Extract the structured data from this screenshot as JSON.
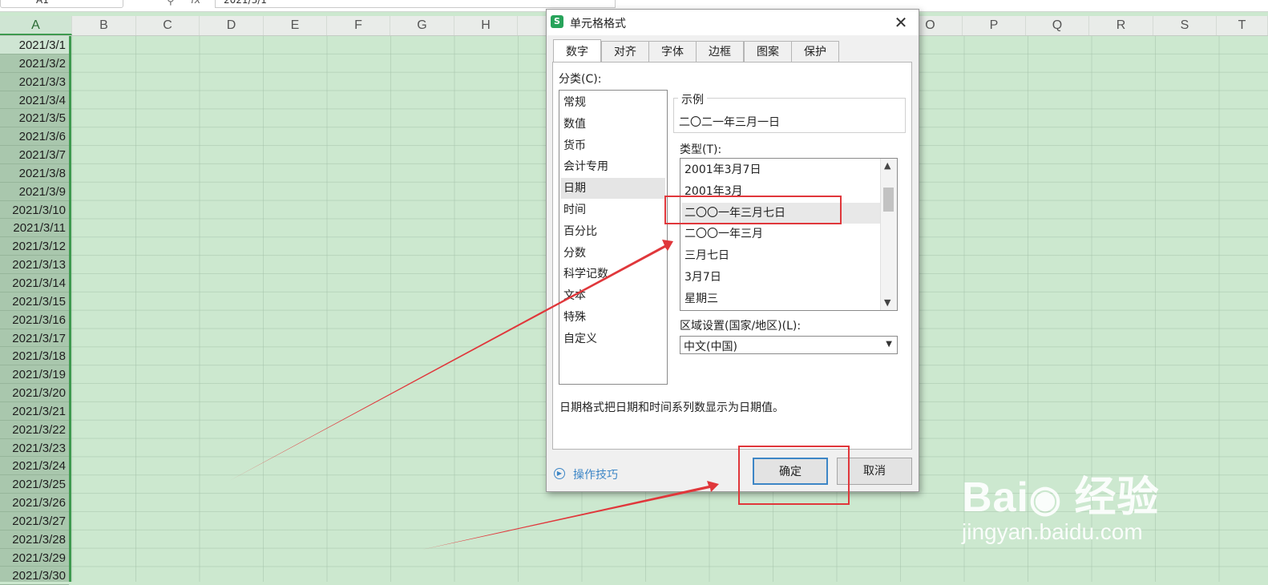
{
  "formula_bar": {
    "name_box": "A1",
    "fx_label": "fx",
    "formula_value": "2021/3/1"
  },
  "columns": [
    "A",
    "B",
    "C",
    "D",
    "E",
    "F",
    "G",
    "H",
    "",
    "",
    "",
    "",
    "",
    "",
    "O",
    "P",
    "Q",
    "R",
    "S",
    "T"
  ],
  "column_a_cells": [
    "2021/3/1",
    "2021/3/2",
    "2021/3/3",
    "2021/3/4",
    "2021/3/5",
    "2021/3/6",
    "2021/3/7",
    "2021/3/8",
    "2021/3/9",
    "2021/3/10",
    "2021/3/11",
    "2021/3/12",
    "2021/3/13",
    "2021/3/14",
    "2021/3/15",
    "2021/3/16",
    "2021/3/17",
    "2021/3/18",
    "2021/3/19",
    "2021/3/20",
    "2021/3/21",
    "2021/3/22",
    "2021/3/23",
    "2021/3/24",
    "2021/3/25",
    "2021/3/26",
    "2021/3/27",
    "2021/3/28",
    "2021/3/29",
    "2021/3/30"
  ],
  "dialog": {
    "app_icon": "S",
    "title": "单元格格式",
    "close_glyph": "✕",
    "tabs": [
      "数字",
      "对齐",
      "字体",
      "边框",
      "图案",
      "保护"
    ],
    "active_tab": "数字",
    "category_label": "分类(C):",
    "categories": [
      "常规",
      "数值",
      "货币",
      "会计专用",
      "日期",
      "时间",
      "百分比",
      "分数",
      "科学记数",
      "文本",
      "特殊",
      "自定义"
    ],
    "selected_category": "日期",
    "sample_label": "示例",
    "sample_value": "二〇二一年三月一日",
    "type_label": "类型(T):",
    "types": [
      "2001年3月7日",
      "2001年3月",
      "二〇〇一年三月七日",
      "二〇〇一年三月",
      "三月七日",
      "3月7日",
      "星期三"
    ],
    "selected_type": "二〇〇一年三月七日",
    "locale_label": "区域设置(国家/地区)(L):",
    "locale_value": "中文(中国)",
    "description": "日期格式把日期和时间系列数显示为日期值。",
    "tips_label": "操作技巧",
    "ok_label": "确定",
    "cancel_label": "取消"
  },
  "watermark": {
    "logo": "Bai du 经验",
    "url": "jingyan.baidu.com"
  },
  "colors": {
    "grid_bg": "#cce8cf",
    "accent_green": "#3e9a4f",
    "annotation_red": "#e0373b",
    "link_blue": "#3d86c6"
  }
}
